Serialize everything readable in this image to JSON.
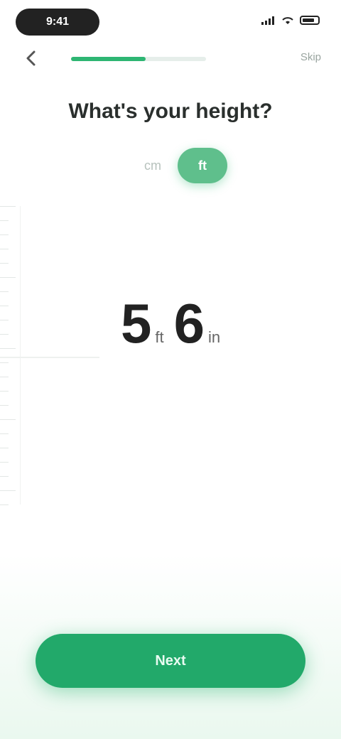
{
  "status_bar": {
    "time": "9:41"
  },
  "header": {
    "back_icon": "chevron-left-icon",
    "progress_fraction": 0.55,
    "progress_color": "#2eb673",
    "skip_label": "Skip"
  },
  "title": "What's your height?",
  "unit_toggle": {
    "options": [
      "cm",
      "ft"
    ],
    "selected": "ft"
  },
  "height": {
    "feet": "5",
    "feet_unit": "ft",
    "inches": "6",
    "inches_unit": "in"
  },
  "next_button": {
    "label": "Next",
    "color": "#22a96a"
  }
}
